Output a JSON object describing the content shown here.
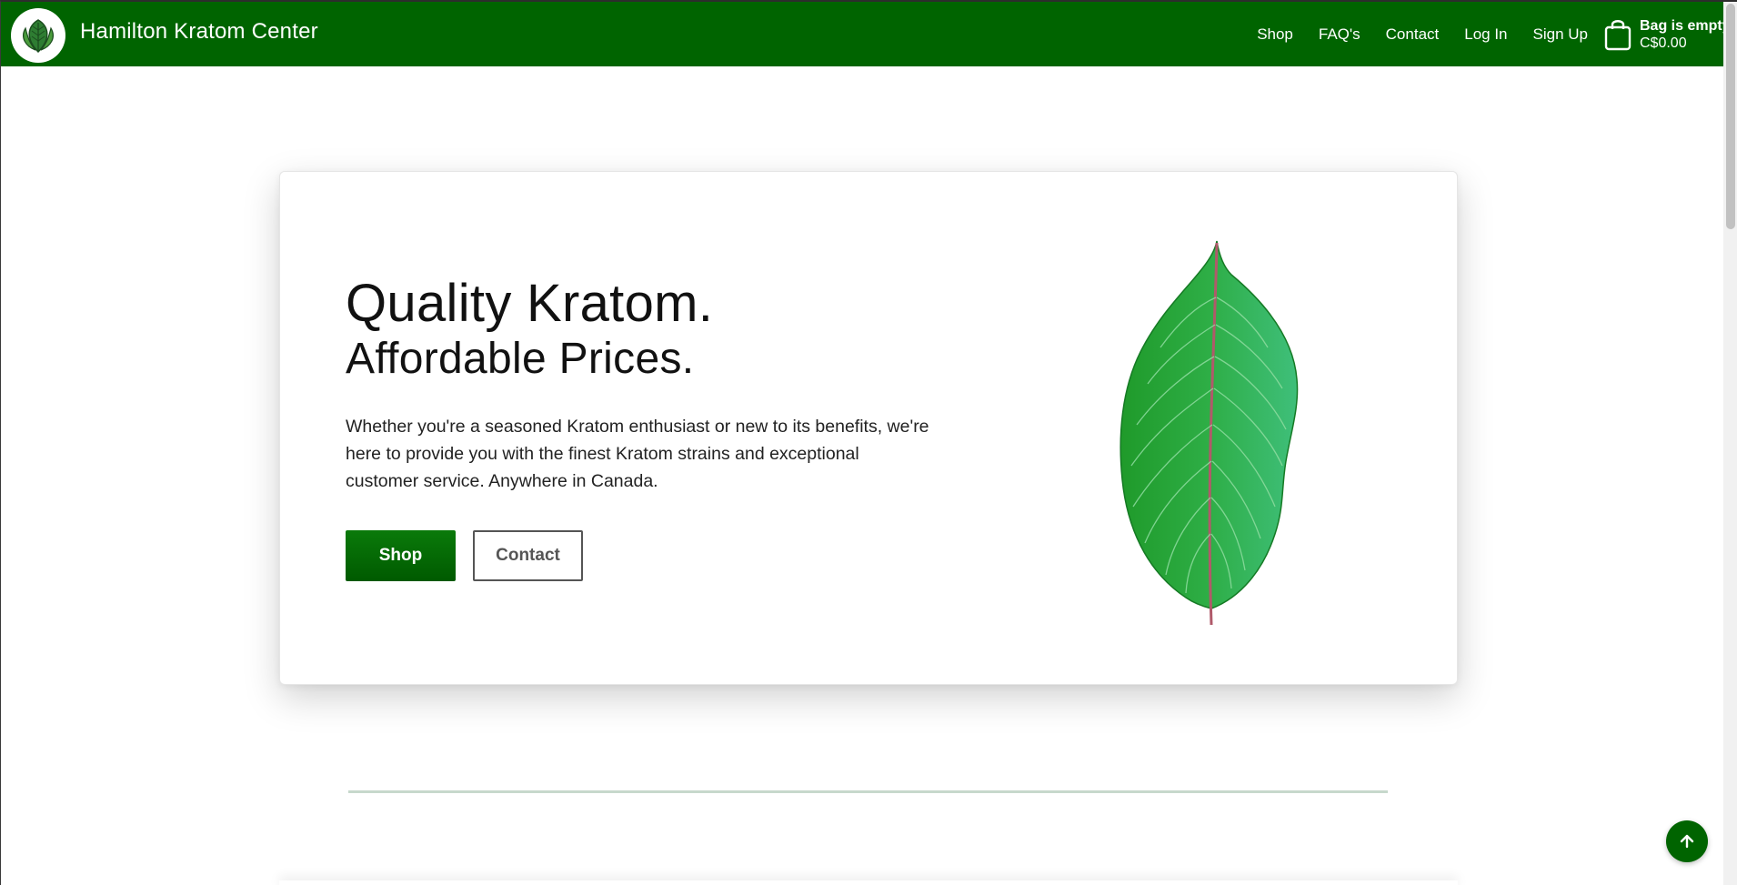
{
  "header": {
    "brand": "Hamilton Kratom Center",
    "logo_icon": "leaf-logo-icon",
    "nav": [
      "Shop",
      "FAQ's",
      "Contact",
      "Log In",
      "Sign Up"
    ],
    "cart": {
      "title": "Bag is empty",
      "amount": "C$0.00",
      "icon": "shopping-bag-icon"
    },
    "background_color": "#006400"
  },
  "hero": {
    "title_line1": "Quality Kratom.",
    "title_line2": "Affordable Prices.",
    "description": "Whether you're a seasoned Kratom enthusiast or new to its benefits, we're here to provide you with the finest Kratom strains and exceptional customer service. Anywhere in Canada.",
    "shop_button": "Shop",
    "contact_button": "Contact",
    "image": "kratom-leaf-image"
  },
  "back_to_top": {
    "icon": "arrow-up-icon"
  },
  "colors": {
    "accent": "#006400",
    "divider": "#c7d8cc"
  }
}
